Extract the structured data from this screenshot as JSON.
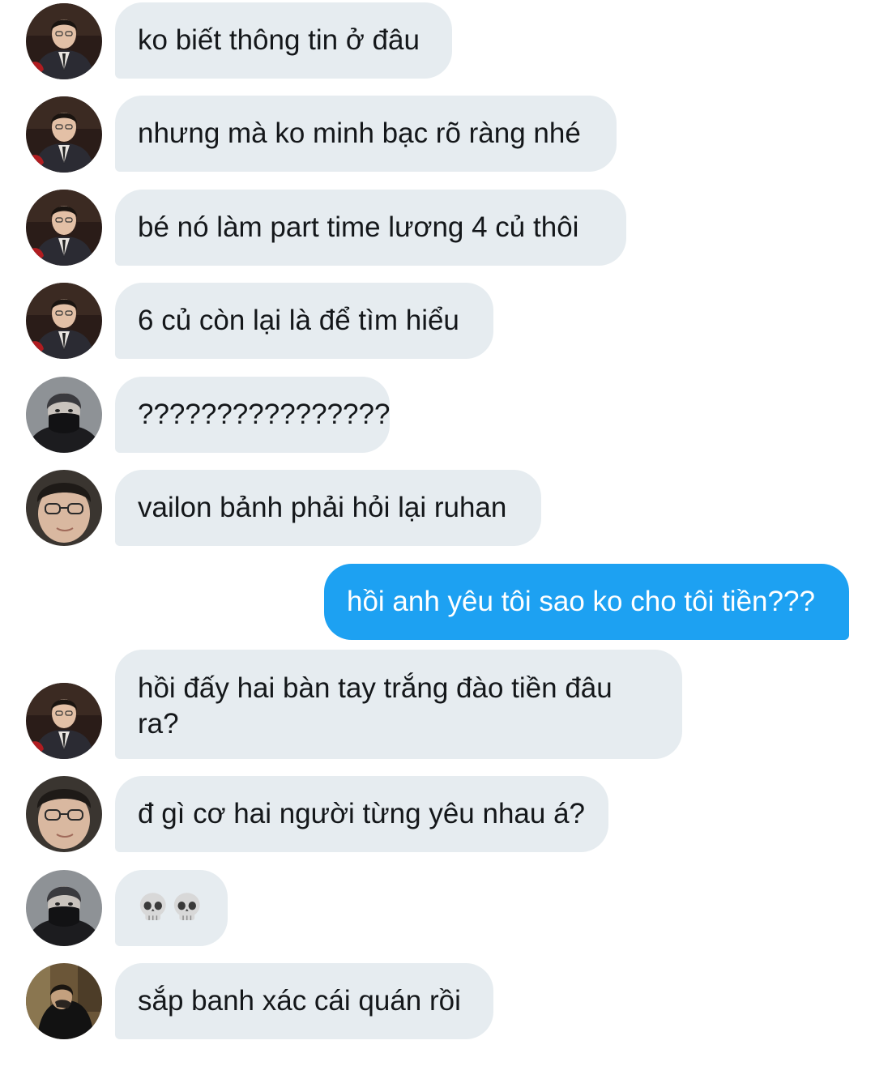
{
  "messages": [
    {
      "sender": "user-a",
      "text": "ko biết thông tin ở đâu"
    },
    {
      "sender": "user-a",
      "text": "nhưng mà ko minh bạc rõ ràng nhé"
    },
    {
      "sender": "user-a",
      "text": "bé nó làm part time lương 4 củ thôi"
    },
    {
      "sender": "user-a",
      "text": "6 củ còn lại là để tìm hiểu"
    },
    {
      "sender": "user-b",
      "text": "????????????????"
    },
    {
      "sender": "user-c",
      "text": "vailon bảnh phải hỏi lại ruhan"
    },
    {
      "sender": "me",
      "text": "hồi anh yêu tôi sao ko cho tôi tiền???"
    },
    {
      "sender": "user-a",
      "text": "hồi đấy hai bàn tay trắng đào tiền đâu\nra?"
    },
    {
      "sender": "user-c",
      "text": "đ gì cơ hai người từng yêu nhau á?"
    },
    {
      "sender": "user-b",
      "emoji": "skull-skull"
    },
    {
      "sender": "user-d",
      "text": "sắp banh xác cái quán rồi"
    }
  ],
  "colors": {
    "received_bubble": "#e6ecf0",
    "sent_bubble": "#1da1f2",
    "received_text": "#14171a",
    "sent_text": "#ffffff"
  }
}
